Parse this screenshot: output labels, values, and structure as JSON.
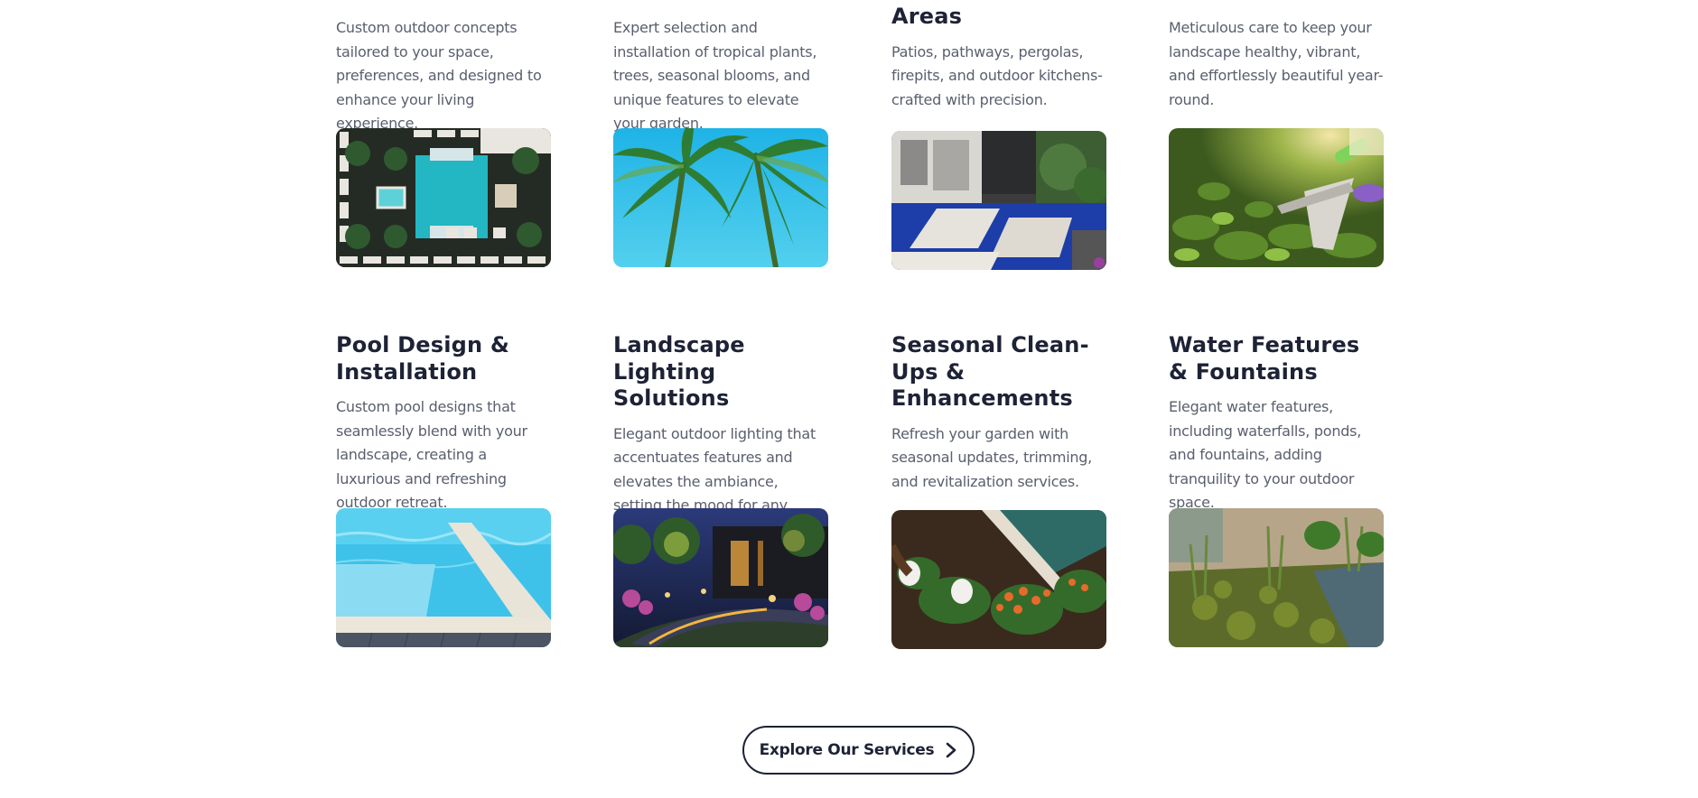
{
  "row1": [
    {
      "title": "",
      "desc": "Custom outdoor concepts tailored to your space, preferences, and designed to enhance your living experience.",
      "image": "aerial-pool-courtyard"
    },
    {
      "title": "",
      "desc": "Expert selection and installation of tropical plants, trees, seasonal blooms, and unique features to elevate your garden.",
      "image": "palm-trees"
    },
    {
      "title": "Areas",
      "desc": "Patios, pathways, pergolas, firepits, and outdoor kitchens-crafted with precision.",
      "image": "modern-patio"
    },
    {
      "title": "",
      "desc": "Meticulous care to keep your landscape healthy, vibrant, and effortlessly beautiful year-round.",
      "image": "pruning-shears"
    }
  ],
  "row2": [
    {
      "title": "Pool Design & Installation",
      "desc": "Custom pool designs that seamlessly blend with your landscape, creating a luxurious and refreshing outdoor retreat.",
      "image": "pool-edge"
    },
    {
      "title": "Landscape Lighting Solutions",
      "desc": "Elegant outdoor lighting that accentuates features and elevates the ambiance, setting the mood for any occasion.",
      "image": "night-garden-lighting"
    },
    {
      "title": "Seasonal Clean-Ups & Enhancements",
      "desc": "Refresh your garden with seasonal updates, trimming, and revitalization services.",
      "image": "planting-flowers"
    },
    {
      "title": "Water Features & Fountains",
      "desc": "Elegant water features, including waterfalls, ponds, and fountains, adding tranquility to your outdoor space.",
      "image": "pond-plants"
    }
  ],
  "cta": {
    "label": "Explore Our Services",
    "icon": "chevron-right-icon"
  },
  "colors": {
    "heading": "#1e2235",
    "body": "#5a5f6e",
    "background": "#ffffff"
  }
}
